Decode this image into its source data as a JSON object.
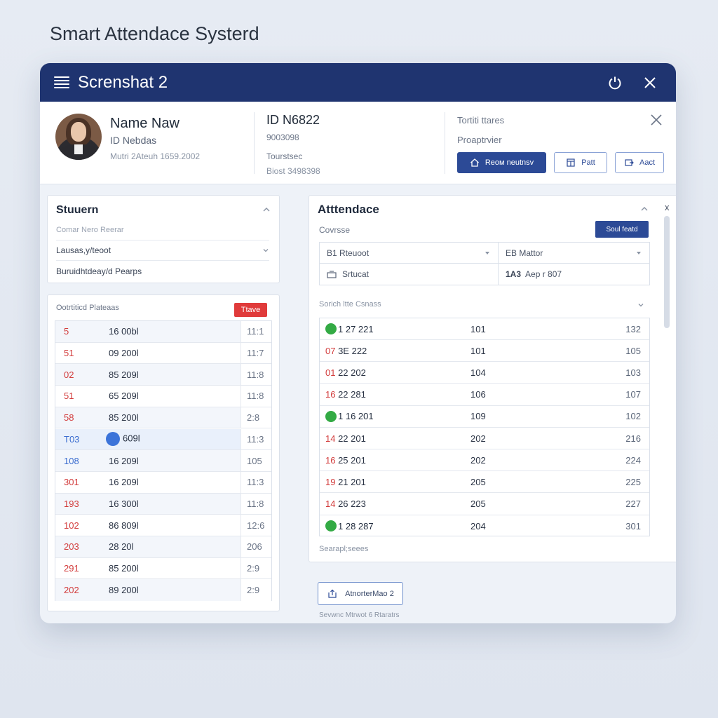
{
  "heading": "Smart Attendace Systerd",
  "window": {
    "title": "Screnshat 2"
  },
  "profile": {
    "name": "Name Naw",
    "id_line": "ID Nebdas",
    "meta": "Mutri 2Ateuh 1659.2002",
    "id_number": "ID N6822",
    "id_sub": "9003098",
    "ts_label": "Tourstsec",
    "ts_value": "Biost 3498398",
    "right_line1": "Tortiti ttares",
    "right_line2": "Proaptrvier",
    "btn_primary": "Reoм neutnsv",
    "btn_print": "Patt",
    "btn_act": "Aact"
  },
  "student_card": {
    "title": "Stuuern",
    "rows": [
      {
        "text": "Comar Nero Reerar",
        "sub": true
      },
      {
        "text": "Lausas,y/teoot",
        "sub": false,
        "dropdown": true
      },
      {
        "text": "Buruidhtdeay/d Pearps",
        "sub": false
      }
    ]
  },
  "student_list": {
    "title": "Ootrtiticd Plateaas",
    "badge": "Ttave",
    "rows": [
      {
        "a": "5",
        "b": "16 00bl",
        "c": "11:1"
      },
      {
        "a": "51",
        "b": "09 200l",
        "c": "11:7"
      },
      {
        "a": "02",
        "b": "85 209l",
        "c": "11:8"
      },
      {
        "a": "51",
        "b": "65 209l",
        "c": "11:8"
      },
      {
        "a": "58",
        "b": "85 200l",
        "c": "2:8"
      },
      {
        "a": "T03",
        "b": "609l",
        "c": "11:3",
        "blue": true,
        "marker": true
      },
      {
        "a": "108",
        "b": "16 209l",
        "c": "105",
        "blue": true
      },
      {
        "a": "301",
        "b": "16 209l",
        "c": "11:3"
      },
      {
        "a": "193",
        "b": "16 300l",
        "c": "11:8"
      },
      {
        "a": "102",
        "b": "86 809l",
        "c": "12:6"
      },
      {
        "a": "203",
        "b": "28 20l",
        "c": "206"
      },
      {
        "a": "291",
        "b": "85 200l",
        "c": "2:9"
      },
      {
        "a": "202",
        "b": "89 200l",
        "c": "2:9"
      }
    ]
  },
  "attendance": {
    "title": "Atttendace",
    "course_label": "Covrsse",
    "course_button": "Soul featd",
    "filter_a": "B1 Rteuoot",
    "filter_b": "EB Mattor",
    "filter_c": "Srtucat",
    "filter_d": "Aep r 807",
    "filter_d_prefix": "1A3",
    "section_label": "Sorich ltte Csnass",
    "rows": [
      {
        "a": "1 27 221",
        "b": "101",
        "c": "132",
        "dot": true
      },
      {
        "a": "07 3E 222",
        "b": "101",
        "c": "105",
        "prefix": "07"
      },
      {
        "a": "01 22 202",
        "b": "104",
        "c": "103",
        "prefix": "01"
      },
      {
        "a": "16 22 281",
        "b": "106",
        "c": "107",
        "prefix": "16"
      },
      {
        "a": "1 16 201",
        "b": "109",
        "c": "102",
        "dot": true
      },
      {
        "a": "14 22 201",
        "b": "202",
        "c": "216",
        "prefix": "14",
        "c_red": true
      },
      {
        "a": "16 25 201",
        "b": "202",
        "c": "224",
        "prefix": "16",
        "c_red": true
      },
      {
        "a": "19 21 201",
        "b": "205",
        "c": "225",
        "prefix": "19"
      },
      {
        "a": "14 26 223",
        "b": "205",
        "c": "227",
        "prefix": "14"
      },
      {
        "a": "1 28 287",
        "b": "204",
        "c": "301",
        "dot": true
      }
    ],
    "footer": "Searapl;seees"
  },
  "bottom_button": "AtnorterMao 2",
  "bottom_caption": "Sevwnc Mtrwot 6 Rtaratrs",
  "colors": {
    "titlebar": "#1f3470",
    "primary": "#2c4a96",
    "accent_red": "#d23b3b",
    "present_green": "#33aa44"
  }
}
